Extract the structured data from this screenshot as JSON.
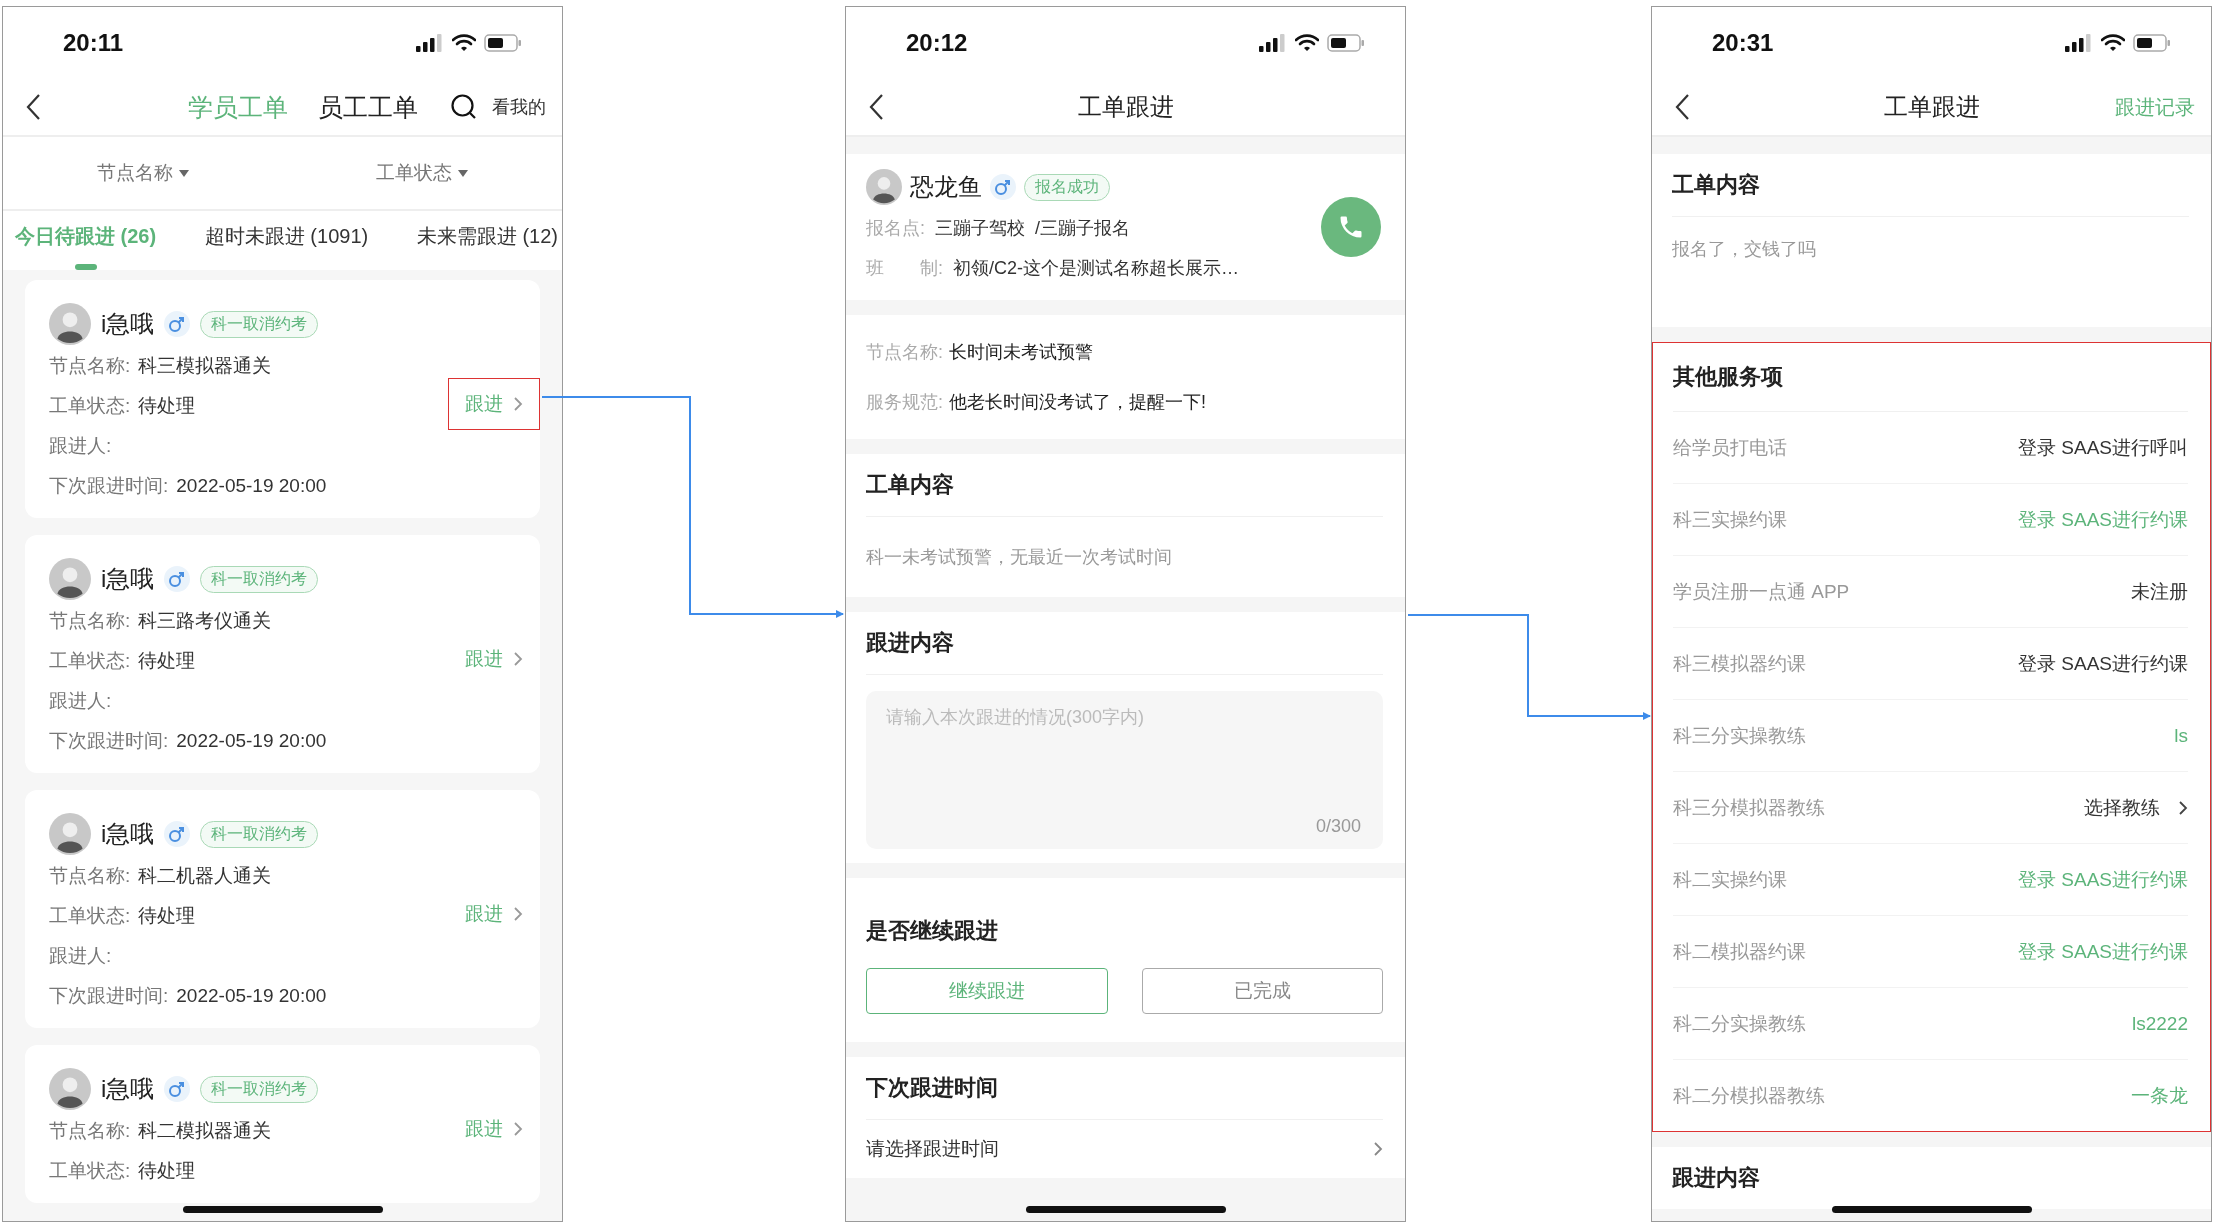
{
  "list_screen": {
    "time": "20:11",
    "nav_tabs": [
      {
        "label": "学员工单",
        "selected": true
      },
      {
        "label": "员工工单",
        "selected": false
      }
    ],
    "nav_action": "看我的",
    "filters": [
      "节点名称",
      "工单状态"
    ],
    "tabs": [
      {
        "label": "今日待跟进 (26)",
        "selected": true
      },
      {
        "label": "超时未跟进 (1091)",
        "selected": false
      },
      {
        "label": "未来需跟进 (12)",
        "selected": false
      }
    ],
    "cards": [
      {
        "name": "i急哦",
        "tag": "科一取消约考",
        "fields": [
          {
            "label": "节点名称:",
            "value": "科三模拟器通关"
          },
          {
            "label": "工单状态:",
            "value": "待处理"
          },
          {
            "label": "跟进人:"
          },
          {
            "label": "下次跟进时间:",
            "value": "2022-05-19 20:00"
          }
        ],
        "action": "跟进",
        "highlighted": true
      },
      {
        "name": "i急哦",
        "tag": "科一取消约考",
        "fields": [
          {
            "label": "节点名称:",
            "value": "科三路考仪通关"
          },
          {
            "label": "工单状态:",
            "value": "待处理"
          },
          {
            "label": "跟进人:"
          },
          {
            "label": "下次跟进时间:",
            "value": "2022-05-19 20:00"
          }
        ],
        "action": "跟进",
        "highlighted": false
      },
      {
        "name": "i急哦",
        "tag": "科一取消约考",
        "fields": [
          {
            "label": "节点名称:",
            "value": "科二机器人通关"
          },
          {
            "label": "工单状态:",
            "value": "待处理"
          },
          {
            "label": "跟进人:"
          },
          {
            "label": "下次跟进时间:",
            "value": "2022-05-19 20:00"
          }
        ],
        "action": "跟进",
        "highlighted": false
      },
      {
        "name": "i急哦",
        "tag": "科一取消约考",
        "fields": [
          {
            "label": "节点名称:",
            "value": "科二模拟器通关"
          },
          {
            "label": "工单状态:",
            "value": "待处理"
          }
        ],
        "action": "跟进",
        "highlighted": false
      }
    ]
  },
  "detail_screen": {
    "time": "20:12",
    "title": "工单跟进",
    "student": {
      "name": "恐龙鱼",
      "tag": "报名成功",
      "rows": [
        {
          "label": "报名点:",
          "value": "三蹦子驾校  /三蹦子报名"
        },
        {
          "label": "班　　制:",
          "value": "初领/C2-这个是测试名称超长展示…"
        }
      ]
    },
    "node_rows": [
      {
        "label": "节点名称:",
        "value": "长时间未考试预警"
      },
      {
        "label": "服务规范:",
        "value": "他老长时间没考试了，提醒一下!"
      }
    ],
    "content": {
      "title": "工单内容",
      "text": "科一未考试预警，无最近一次考试时间"
    },
    "followup": {
      "title": "跟进内容",
      "placeholder": "请输入本次跟进的情况(300字内)",
      "counter": "0/300"
    },
    "continue": {
      "title": "是否继续跟进",
      "options": [
        {
          "label": "继续跟进",
          "selected": true
        },
        {
          "label": "已完成",
          "selected": false
        }
      ]
    },
    "next_time": {
      "title": "下次跟进时间",
      "placeholder": "请选择跟进时间"
    }
  },
  "services_screen": {
    "time": "20:31",
    "title": "工单跟进",
    "nav_action": "跟进记录",
    "content": {
      "title": "工单内容",
      "text": "报名了，交钱了吗"
    },
    "services": {
      "title": "其他服务项",
      "highlighted": true,
      "rows": [
        {
          "label": "给学员打电话",
          "value": "登录 SAAS进行呼叫",
          "kind": "text"
        },
        {
          "label": "科三实操约课",
          "value": "登录 SAAS进行约课",
          "kind": "link"
        },
        {
          "label": "学员注册一点通 APP",
          "value": "未注册",
          "kind": "text"
        },
        {
          "label": "科三模拟器约课",
          "value": "登录 SAAS进行约课",
          "kind": "text"
        },
        {
          "label": "科三分实操教练",
          "value": "ls",
          "kind": "link"
        },
        {
          "label": "科三分模拟器教练",
          "value": "选择教练",
          "kind": "picker"
        },
        {
          "label": "科二实操约课",
          "value": "登录 SAAS进行约课",
          "kind": "link"
        },
        {
          "label": "科二模拟器约课",
          "value": "登录 SAAS进行约课",
          "kind": "link"
        },
        {
          "label": "科二分实操教练",
          "value": "ls2222",
          "kind": "link"
        },
        {
          "label": "科二分模拟器教练",
          "value": "一条龙",
          "kind": "link"
        }
      ]
    },
    "followup_title": "跟进内容"
  }
}
